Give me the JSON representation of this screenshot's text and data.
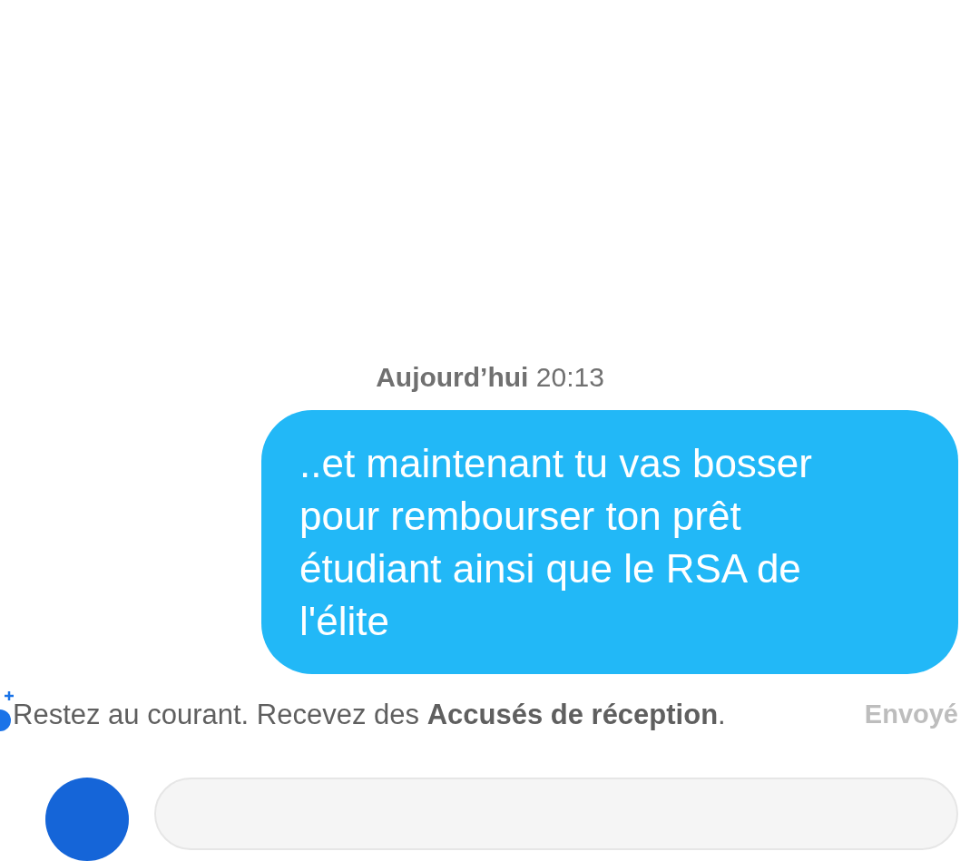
{
  "timestamp": "**Aujourd’hui** 20:13",
  "message": {
    "text": "..et maintenant tu vas bosser pour rembourser ton prêt étudiant ainsi que le RSA de l'élite"
  },
  "receipt_notice": "Restez au courant. Recevez des **Accusés de réception**.",
  "status": "Envoyé"
}
